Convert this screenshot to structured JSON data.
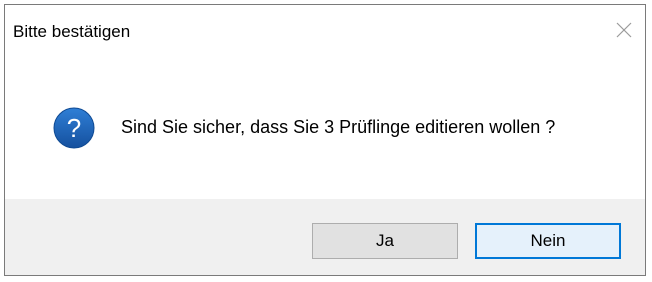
{
  "window": {
    "title": "Bitte bestätigen",
    "close_icon": "close-icon"
  },
  "message": {
    "icon": "question-icon",
    "icon_color": "#1a5fb4",
    "text": "Sind Sie sicher, dass Sie 3 Prüflinge editieren wollen ?"
  },
  "buttons": {
    "yes_label": "Ja",
    "no_label": "Nein",
    "default_border_color": "#0078d7"
  }
}
